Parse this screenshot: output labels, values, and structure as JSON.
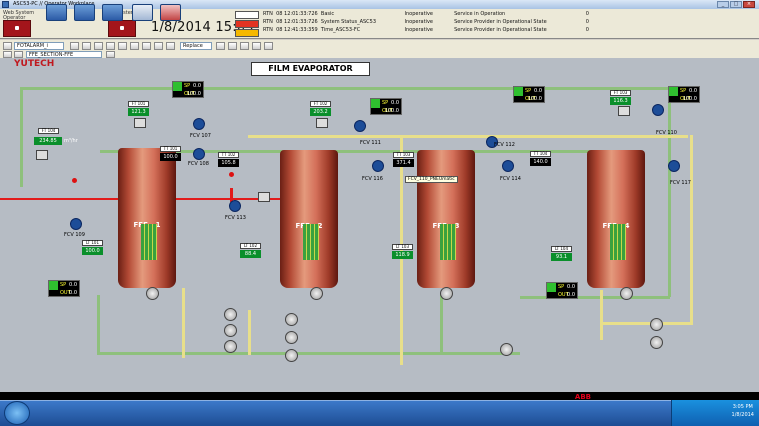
{
  "window": {
    "title": "ASC53-PC // Operator Workplace"
  },
  "header": {
    "web_system_label": "Web System",
    "web_system_sub": "Operator",
    "system_label": "System",
    "datetime": "1/8/2014 15:05",
    "events": [
      {
        "rtn": "RTN",
        "time": "08 12:01:33:726",
        "source": "Basic",
        "state": "Inoperative",
        "msg": "Service in Operation",
        "count": "0"
      },
      {
        "rtn": "RTN",
        "time": "08 12:01:33:726",
        "source": "System Status_ASC53",
        "state": "Inoperative",
        "msg": "Service Provider in Operational State",
        "count": "0"
      },
      {
        "rtn": "RTN",
        "time": "08 12:41:33:359",
        "source": "Time_ASC53-FC",
        "state": "Inoperative",
        "msg": "Service Provider in Operational State",
        "count": "0"
      }
    ]
  },
  "toolbar": {
    "combo1": "FOTALARM_i",
    "replace_label": "Replace",
    "combo2": "FFE_SECTION-FFE"
  },
  "process": {
    "brand": "YUTECH",
    "title": "FILM EVAPORATOR",
    "vessels": [
      {
        "name": "FFE - 1"
      },
      {
        "name": "FFE - 2"
      },
      {
        "name": "FFE - 3"
      },
      {
        "name": "FFE - 4"
      }
    ],
    "control_panels": [
      {
        "sp": "0.0",
        "out": "100.0"
      },
      {
        "sp": "0.0",
        "out": "100.0"
      },
      {
        "sp": "0.0",
        "out": "100.0"
      },
      {
        "sp": "0.0",
        "out": "100.0"
      },
      {
        "sp": "0.0",
        "out": "0.0"
      },
      {
        "sp": "0.0",
        "out": "0.0"
      }
    ],
    "sp_label": "SP",
    "out_label": "OUT",
    "tags": [
      {
        "tag": "FT 104",
        "value": "234.85"
      },
      {
        "tag": "FT 101",
        "value": "121.3"
      },
      {
        "tag": "FT 102",
        "value": "203.2"
      },
      {
        "tag": "FT 103",
        "value": "116.3"
      },
      {
        "tag": "LT 101",
        "value": "100.0"
      },
      {
        "tag": "LT 102",
        "value": "88.4"
      },
      {
        "tag": "LT 103",
        "value": "118.9"
      },
      {
        "tag": "LT 104",
        "value": "93.1"
      },
      {
        "tag": "TT 101",
        "value": "100.0"
      },
      {
        "tag": "TT 102",
        "value": "105.8"
      },
      {
        "tag": "TT 103",
        "value": "371.4"
      },
      {
        "tag": "TT 104",
        "value": "140.0"
      }
    ],
    "unit_m3h": "m³/hr",
    "valves": [
      "FCV 107",
      "FCV 108",
      "FCV 109",
      "FCV 110",
      "FCV 111",
      "FCV 112",
      "FCV 113",
      "FCV 114",
      "FCV 116",
      "FCV 117"
    ],
    "tooltip": "FCV_110_PNEUmatic"
  },
  "status_bar": {
    "brand": "ABB"
  },
  "taskbar": {
    "time": "3:05 PM",
    "date": "1/8/2014"
  },
  "colors": {
    "alarm_red": "#a3151b",
    "running_green": "#2fbf2f",
    "vessel": "#b34a35",
    "pipe_green": "#8ec07c",
    "pipe_yellow": "#e8df8a"
  }
}
